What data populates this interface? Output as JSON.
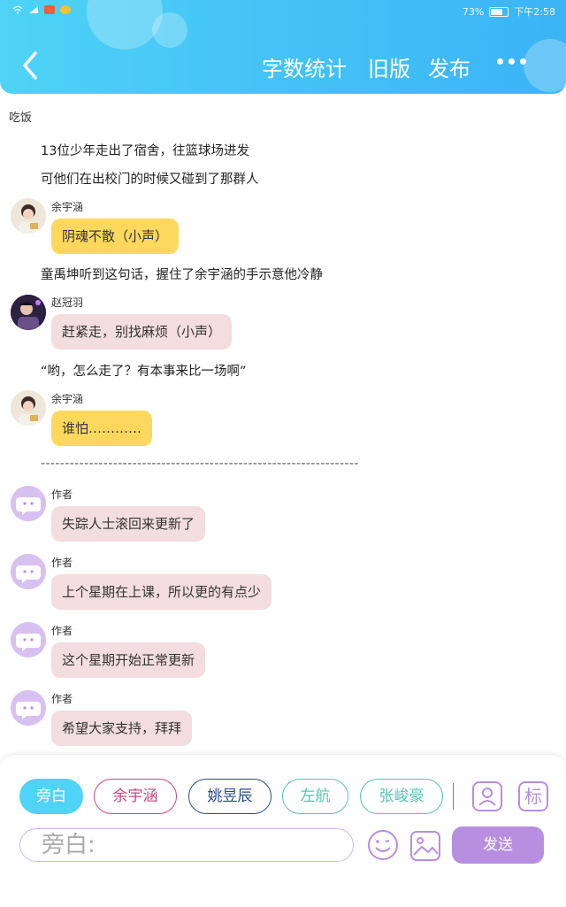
{
  "status_bar": {
    "battery": "73%",
    "time": "下午2:58"
  },
  "header": {
    "word_count": "字数统计",
    "old_version": "旧版",
    "publish": "发布"
  },
  "chapter_title": "吃饭",
  "narration": [
    "13位少年走出了宿舍，往篮球场进发",
    "可他们在出校门的时候又碰到了那群人",
    "童禹坤听到这句话，握住了余宇涵的手示意他冷静",
    "“哟，怎么走了？有本事来比一场啊”"
  ],
  "messages": [
    {
      "name": "余宇涵",
      "text": "阴魂不散（小声）"
    },
    {
      "name": "赵冠羽",
      "text": "赶紧走，别找麻烦（小声）"
    },
    {
      "name": "余宇涵",
      "text": "谁怕…………"
    },
    {
      "name": "作者",
      "text": "失踪人士滚回来更新了"
    },
    {
      "name": "作者",
      "text": "上个星期在上课，所以更的有点少"
    },
    {
      "name": "作者",
      "text": "这个星期开始正常更新"
    },
    {
      "name": "作者",
      "text": "希望大家支持，拜拜"
    }
  ],
  "divider": "------------------------------------------------------------------",
  "roles": [
    "旁白",
    "余宇涵",
    "姚昱辰",
    "左航",
    "张峻豪"
  ],
  "tag_button": "标",
  "input": {
    "placeholder": "旁白:"
  },
  "send_label": "发送",
  "colors": {
    "header": "#45c6f6",
    "narrator_active": "#4fd3f6",
    "accent_purple": "#b78ee0",
    "bubble_yellow": "#fdd85d",
    "bubble_pink": "#f3dde0"
  }
}
